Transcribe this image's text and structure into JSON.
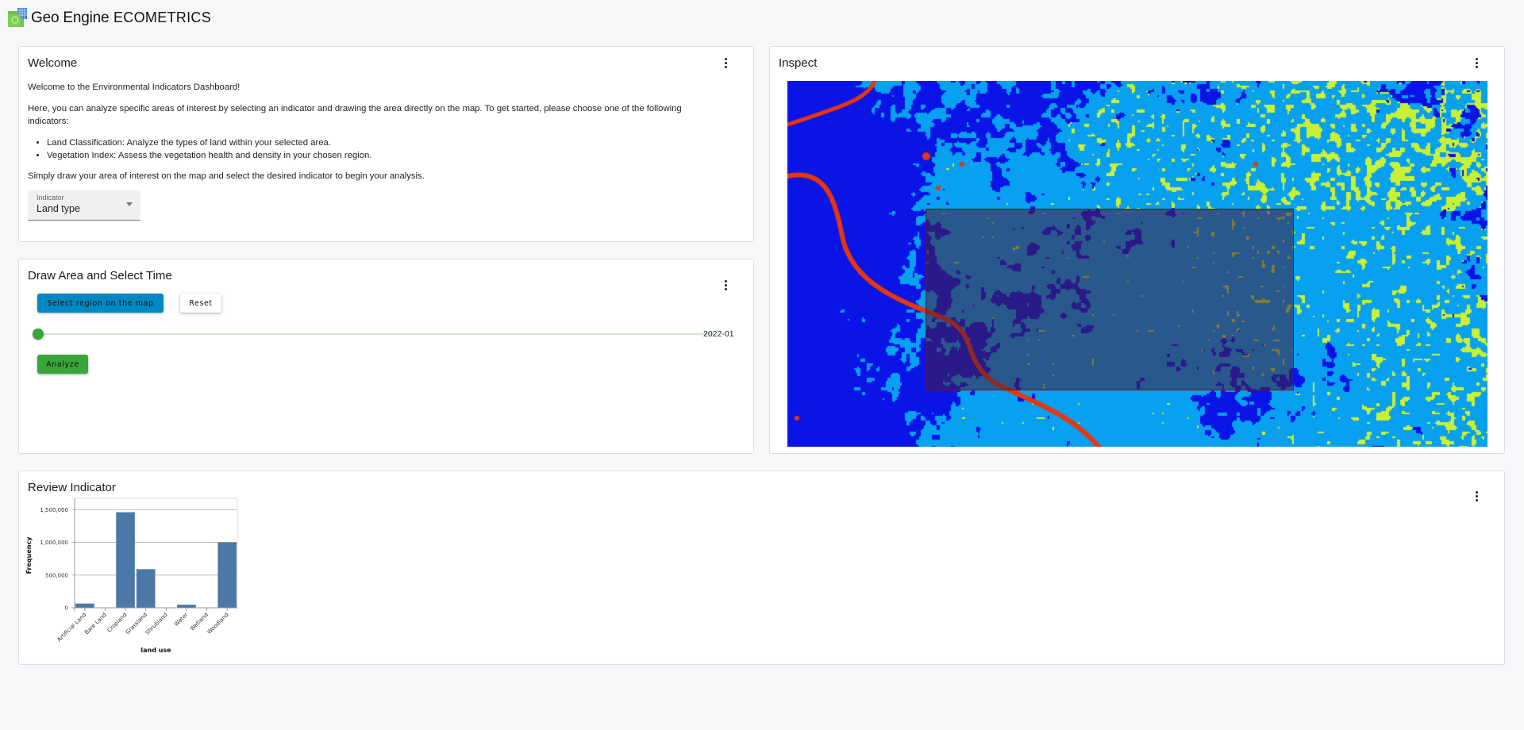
{
  "header": {
    "brand": "Geo Engine",
    "app_title": "ECOMETRICS",
    "logo_icon": "geo-engine-logo"
  },
  "welcome": {
    "title": "Welcome",
    "menu_icon": "more-vert-icon",
    "intro": "Welcome to the Environmental Indicators Dashboard!",
    "paragraph_line1": "Here, you can analyze specific areas of interest by selecting an indicator and drawing the area directly on the map. To get started, please choose one of the following",
    "paragraph_line2": "indicators:",
    "bullets": [
      "Land Classification: Analyze the types of land within your selected area.",
      "Vegetation Index: Assess the vegetation health and density in your chosen region."
    ],
    "closing": "Simply draw your area of interest on the map and select the desired indicator to begin your analysis.",
    "indicator_select": {
      "label": "Indicator",
      "value": "Land type"
    }
  },
  "draw": {
    "title": "Draw Area and Select Time",
    "menu_icon": "more-vert-icon",
    "select_region_label": "Select region on the map",
    "reset_label": "Reset",
    "time_slider": {
      "value": "2022-01",
      "position_fraction": 0.0
    },
    "analyze_label": "Analyze",
    "colors": {
      "primary": "#0288c3",
      "success": "#3aa63a"
    }
  },
  "inspect": {
    "title": "Inspect",
    "menu_icon": "more-vert-icon",
    "map": {
      "layer_palette": [
        "#0a14e6",
        "#08a0f0",
        "#c8f034",
        "#e8360c"
      ],
      "selection_border_color": "#7a1010"
    }
  },
  "review": {
    "title": "Review Indicator",
    "menu_icon": "more-vert-icon"
  },
  "chart_data": {
    "type": "bar",
    "title": "",
    "xlabel": "land use",
    "ylabel": "Frequency",
    "categories": [
      "Artificial Land",
      "Bare Land",
      "Cropland",
      "Grassland",
      "Shrubland",
      "Water",
      "Wetland",
      "Woodland"
    ],
    "values": [
      65000,
      0,
      1460000,
      590000,
      0,
      47000,
      0,
      1000000
    ],
    "ylim": [
      0,
      1600000
    ],
    "yticks": [
      0,
      500000,
      1000000,
      1500000
    ],
    "ytick_labels": [
      "0",
      "500,000",
      "1,000,000",
      "1,500,000"
    ],
    "grid": true,
    "bar_color": "#4c78a8"
  }
}
